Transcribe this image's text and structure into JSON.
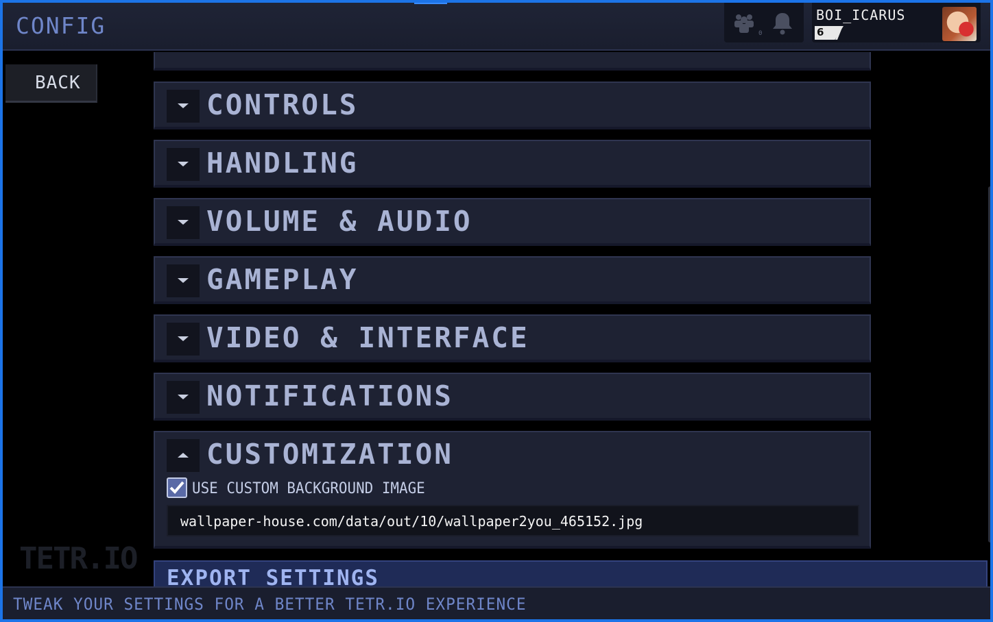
{
  "header": {
    "title": "CONFIG",
    "notification_count": "0",
    "user": {
      "name": "BOI_ICARUS",
      "level": "6"
    }
  },
  "nav": {
    "back_label": "BACK"
  },
  "logo_text": "TETR.IO",
  "sections": [
    {
      "label": "CONTROLS",
      "expanded": false
    },
    {
      "label": "HANDLING",
      "expanded": false
    },
    {
      "label": "VOLUME & AUDIO",
      "expanded": false
    },
    {
      "label": "GAMEPLAY",
      "expanded": false
    },
    {
      "label": "VIDEO & INTERFACE",
      "expanded": false
    },
    {
      "label": "NOTIFICATIONS",
      "expanded": false
    },
    {
      "label": "CUSTOMIZATION",
      "expanded": true
    }
  ],
  "customization": {
    "use_custom_background_label": "USE CUSTOM BACKGROUND IMAGE",
    "use_custom_background_checked": true,
    "background_url": "wallpaper-house.com/data/out/10/wallpaper2you_465152.jpg"
  },
  "export": {
    "label": "EXPORT SETTINGS"
  },
  "footer": {
    "tip": "TWEAK YOUR SETTINGS FOR A BETTER TETR.IO EXPERIENCE"
  },
  "colors": {
    "accent": "#1c74e8",
    "section_bg": "#1e2233",
    "label": "#a9b3d4",
    "export_bg": "#1f2b57"
  },
  "icons": [
    "social-icon",
    "bell-icon",
    "chevron-down-icon",
    "chevron-up-icon",
    "checkmark-icon"
  ]
}
